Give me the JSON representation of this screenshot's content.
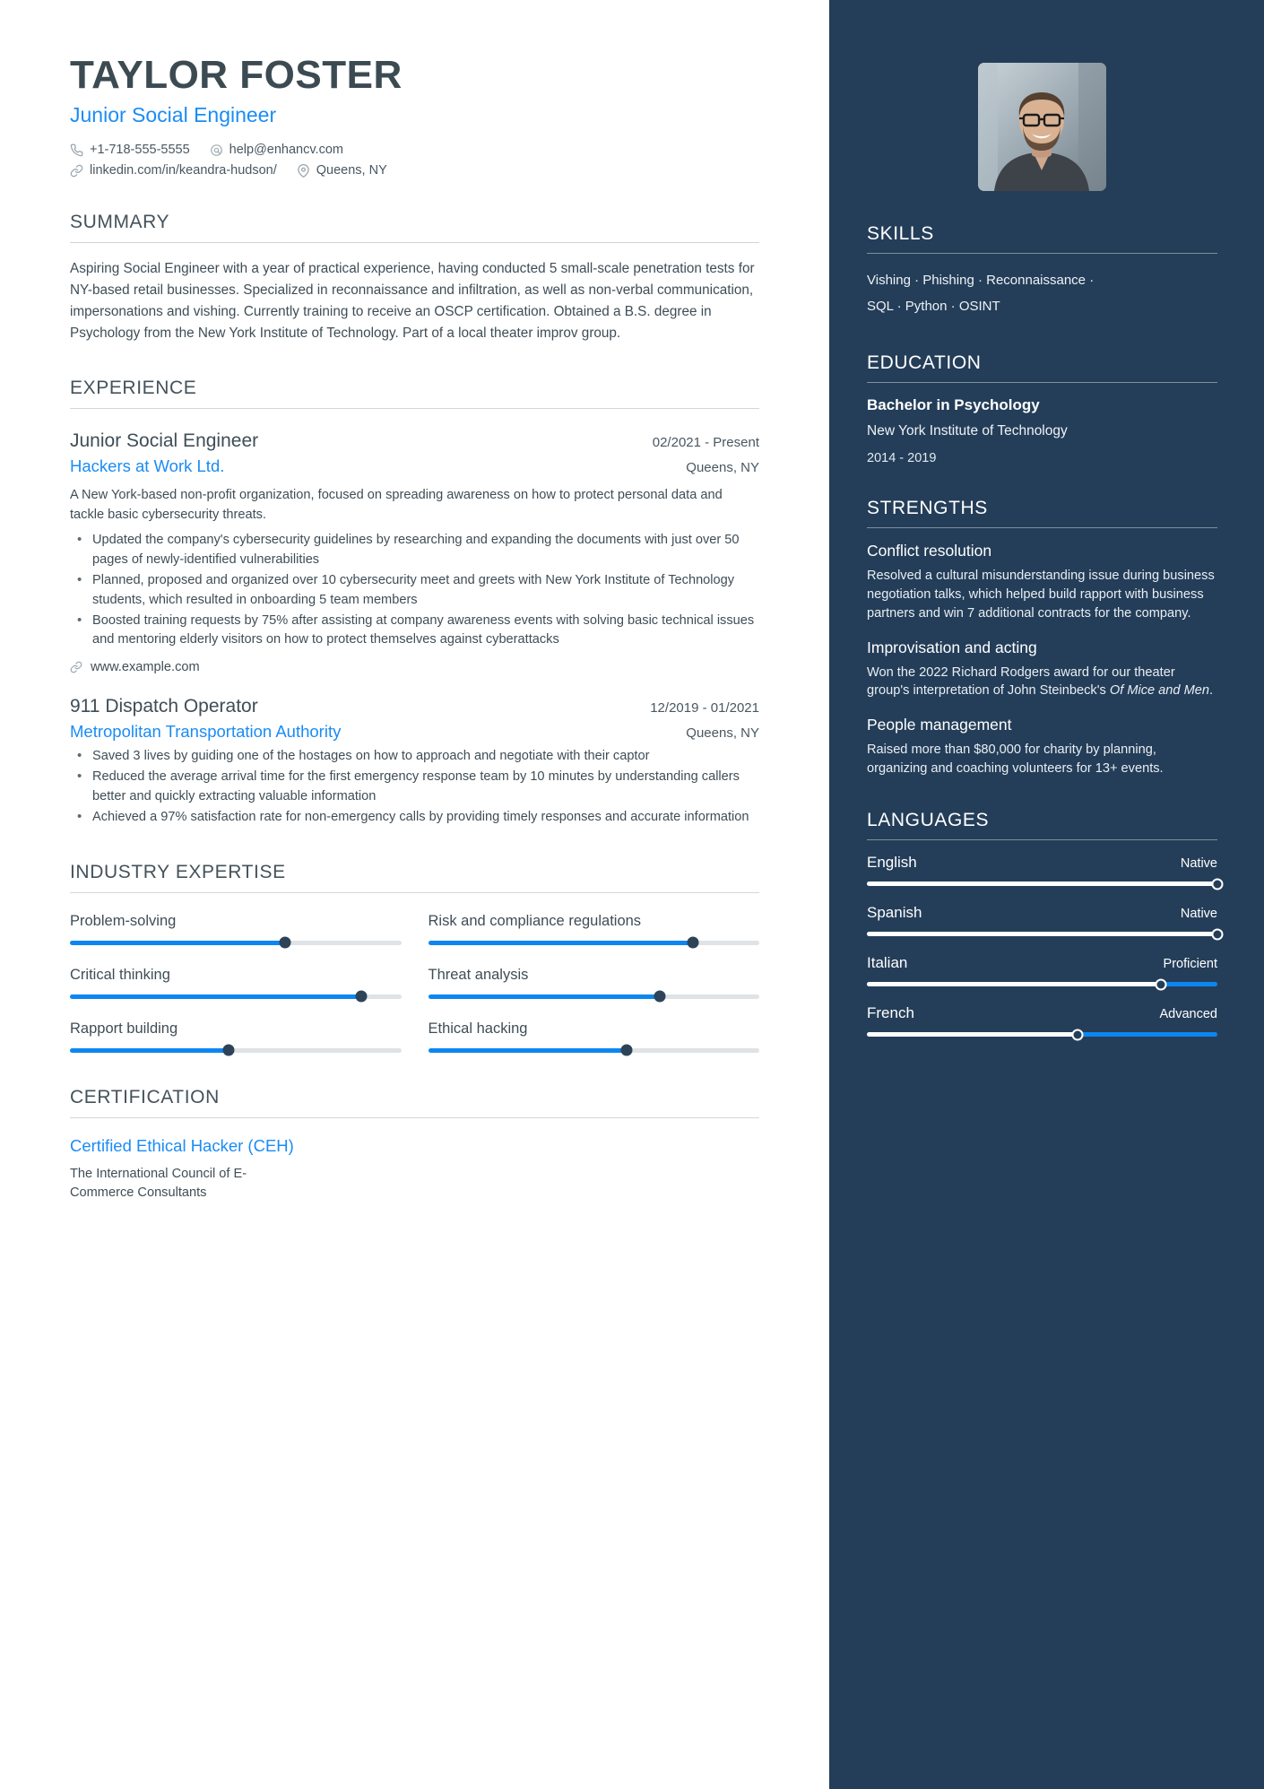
{
  "header": {
    "name": "TAYLOR FOSTER",
    "title": "Junior Social Engineer",
    "contacts": [
      {
        "icon": "phone-icon",
        "text": "+1-718-555-5555"
      },
      {
        "icon": "email-icon",
        "text": "help@enhancv.com"
      },
      {
        "icon": "link-icon",
        "text": "linkedin.com/in/keandra-hudson/"
      },
      {
        "icon": "location-icon",
        "text": "Queens, NY"
      }
    ]
  },
  "summary": {
    "title": "SUMMARY",
    "text": "Aspiring Social Engineer with a year of practical experience, having conducted 5 small-scale penetration tests for NY-based retail businesses. Specialized in reconnaissance and infiltration, as well as non-verbal communication, impersonations and vishing. Currently training to receive an OSCP certification. Obtained a B.S. degree in Psychology from the New York Institute of Technology. Part of a local theater improv group."
  },
  "experience": {
    "title": "EXPERIENCE",
    "entries": [
      {
        "role": "Junior Social Engineer",
        "date": "02/2021 - Present",
        "company": "Hackers at Work Ltd.",
        "location": "Queens, NY",
        "description": "A New York-based non-profit organization, focused on spreading awareness on how to protect personal data and tackle basic cybersecurity threats.",
        "bullets": [
          "Updated the company's cybersecurity guidelines by researching and expanding the documents with just over 50 pages of newly-identified vulnerabilities",
          "Planned, proposed and organized over 10 cybersecurity meet and greets with New York Institute of Technology students, which resulted in onboarding 5 team members",
          "Boosted training requests by 75% after assisting at company awareness events with solving basic technical issues and mentoring elderly visitors on how to protect themselves against cyberattacks"
        ],
        "link": "www.example.com"
      },
      {
        "role": "911 Dispatch Operator",
        "date": "12/2019 - 01/2021",
        "company": "Metropolitan Transportation Authority",
        "location": "Queens, NY",
        "description": "",
        "bullets": [
          "Saved 3 lives by guiding one of the hostages on how to approach and negotiate with their captor",
          "Reduced the average arrival time for the first emergency response team by 10 minutes by understanding callers better and quickly extracting valuable information",
          "Achieved a 97% satisfaction rate for non-emergency calls by providing timely responses and accurate information"
        ],
        "link": ""
      }
    ]
  },
  "industry_expertise": {
    "title": "INDUSTRY EXPERTISE",
    "items": [
      {
        "label": "Problem-solving",
        "value": 65
      },
      {
        "label": "Risk and compliance regulations",
        "value": 80
      },
      {
        "label": "Critical thinking",
        "value": 88
      },
      {
        "label": "Threat analysis",
        "value": 70
      },
      {
        "label": "Rapport building",
        "value": 48
      },
      {
        "label": "Ethical hacking",
        "value": 60
      }
    ]
  },
  "certification": {
    "title": "CERTIFICATION",
    "name": "Certified Ethical Hacker (CEH)",
    "organization": "The International Council of E-Commerce Consultants"
  },
  "sidebar": {
    "skills": {
      "title": "SKILLS",
      "lines": [
        "Vishing · Phishing · Reconnaissance ·",
        "SQL · Python · OSINT"
      ]
    },
    "education": {
      "title": "EDUCATION",
      "degree": "Bachelor in Psychology",
      "school": "New York Institute of Technology",
      "years": "2014 - 2019"
    },
    "strengths": {
      "title": "STRENGTHS",
      "items": [
        {
          "name": "Conflict resolution",
          "description": "Resolved a cultural misunderstanding issue during business negotiation talks, which helped build rapport with business partners and win 7 additional contracts for the company."
        },
        {
          "name": "Improvisation and acting",
          "description_pre": "Won the 2022 Richard Rodgers award for our theater group's interpretation of John Steinbeck's ",
          "description_italic": "Of Mice and Men",
          "description_post": "."
        },
        {
          "name": "People management",
          "description": "Raised more than $80,000 for charity by planning, organizing and coaching volunteers for 13+ events."
        }
      ]
    },
    "languages": {
      "title": "LANGUAGES",
      "items": [
        {
          "name": "English",
          "level": "Native",
          "value": 100
        },
        {
          "name": "Spanish",
          "level": "Native",
          "value": 100
        },
        {
          "name": "Italian",
          "level": "Proficient",
          "value": 84
        },
        {
          "name": "French",
          "level": "Advanced",
          "value": 60
        }
      ]
    }
  },
  "colors": {
    "accent_blue": "#1a8cf5",
    "sidebar_bg": "#243e59",
    "text_dark": "#3f4d56"
  }
}
